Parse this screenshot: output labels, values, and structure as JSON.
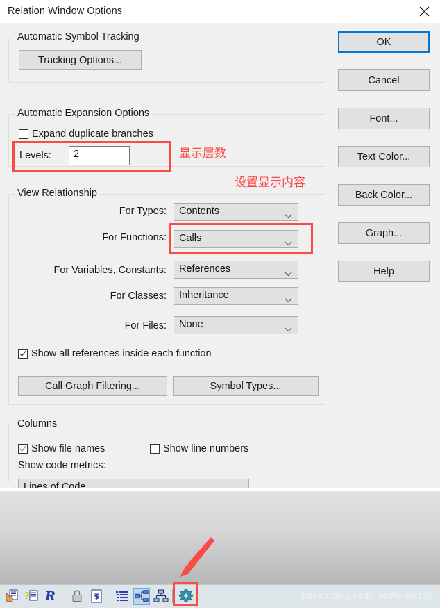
{
  "window": {
    "title": "Relation Window Options",
    "close_icon": "close-icon"
  },
  "groups": {
    "tracking": {
      "title": "Automatic Symbol Tracking",
      "tracking_options_button": "Tracking Options..."
    },
    "expansion": {
      "title": "Automatic Expansion Options",
      "expand_duplicate_label": "Expand duplicate branches",
      "expand_duplicate_checked": false,
      "levels_label": "Levels:",
      "levels_value": "2"
    },
    "view_relationship": {
      "title": "View Relationship",
      "rows": [
        {
          "label": "For Types:",
          "value": "Contents"
        },
        {
          "label": "For Functions:",
          "value": "Calls"
        },
        {
          "label": "For Variables, Constants:",
          "value": "References"
        },
        {
          "label": "For Classes:",
          "value": "Inheritance"
        },
        {
          "label": "For Files:",
          "value": "None"
        }
      ],
      "show_all_refs_label": "Show all references inside each function",
      "show_all_refs_checked": true,
      "call_graph_filtering_button": "Call Graph Filtering...",
      "symbol_types_button": "Symbol Types..."
    },
    "columns": {
      "title": "Columns",
      "show_file_names_label": "Show file names",
      "show_file_names_checked": true,
      "show_line_numbers_label": "Show line numbers",
      "show_line_numbers_checked": false,
      "show_code_metrics_label": "Show code metrics:",
      "code_metrics_value": "Lines of Code"
    }
  },
  "buttons": [
    {
      "label": "OK",
      "default": true
    },
    {
      "label": "Cancel",
      "default": false
    },
    {
      "label": "Font...",
      "default": false
    },
    {
      "label": "Text Color...",
      "default": false
    },
    {
      "label": "Back Color...",
      "default": false
    },
    {
      "label": "Graph...",
      "default": false
    },
    {
      "label": "Help",
      "default": false
    }
  ],
  "annotations": {
    "levels_note": "显示层数",
    "content_note": "设置显示内容",
    "highlight_color": "#fa4b46"
  },
  "toolbar": {
    "icons": [
      "hand-document-icon",
      "question-document-icon",
      "r-letter-icon",
      "lock-icon",
      "document-refresh-icon",
      "list-view-icon",
      "relation-graph-icon",
      "hierarchy-tree-icon",
      "gear-settings-icon"
    ],
    "active_icon": "relation-graph-icon",
    "highlighted_icon": "gear-settings-icon"
  },
  "watermark": "https://blog.csdn.net/lalala12ll",
  "colors": {
    "accent": "#0078d7",
    "dialog_bg": "#f0f0f0",
    "button_bg": "#e1e1e1",
    "annotation_red": "#fa4b46",
    "toolbar_bg": "#dde5e8"
  }
}
